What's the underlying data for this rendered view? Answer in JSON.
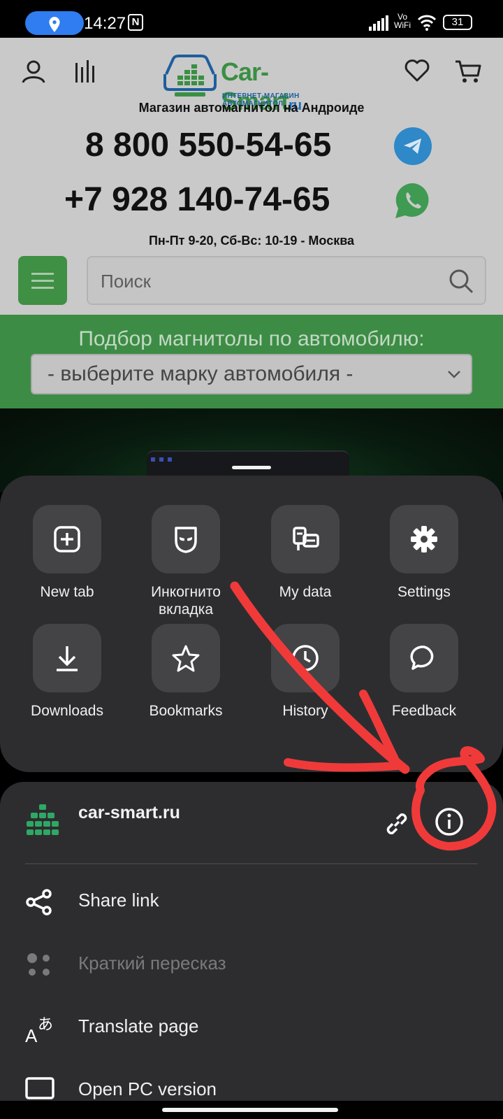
{
  "status_bar": {
    "time": "14:27",
    "nfc_label": "N",
    "network_label_1": "Vo",
    "network_label_2": "WiFi",
    "battery": "31"
  },
  "site": {
    "logo_name": "Car-Smart",
    "logo_tld": "ru",
    "logo_tagline": "ИНТЕРНЕТ-МАГАЗИН АВТОМАГНИТОЛ",
    "tagline": "Магазин автомагнитол на Андроиде",
    "phone_1": "8 800 550-54-65",
    "phone_2": "+7 928 140-74-65",
    "hours": "Пн-Пт 9-20, Сб-Вс: 10-19 - Москва",
    "search_placeholder": "Поиск",
    "picker_title": "Подбор магнитолы по автомобилю:",
    "picker_value": "- выберите марку автомобиля -"
  },
  "menu": {
    "tiles": [
      {
        "label": "New tab",
        "icon": "plus-square-icon"
      },
      {
        "label": "Инкогнито вкладка",
        "icon": "incognito-mask-icon"
      },
      {
        "label": "My data",
        "icon": "my-data-icon"
      },
      {
        "label": "Settings",
        "icon": "gear-icon"
      },
      {
        "label": "Downloads",
        "icon": "download-icon"
      },
      {
        "label": "Bookmarks",
        "icon": "star-icon"
      },
      {
        "label": "History",
        "icon": "clock-icon"
      },
      {
        "label": "Feedback",
        "icon": "chat-bubble-icon"
      }
    ],
    "site_domain": "car-smart.ru",
    "items": [
      {
        "label": "Share link",
        "icon": "share-icon",
        "enabled": true
      },
      {
        "label": "Краткий пересказ",
        "icon": "summary-icon",
        "enabled": false
      },
      {
        "label": "Translate page",
        "icon": "translate-icon",
        "enabled": true
      },
      {
        "label": "Open PC version",
        "icon": "desktop-icon",
        "enabled": true
      }
    ]
  },
  "colors": {
    "sheet_bg": "#2d2d30",
    "site_green": "#3d8c45",
    "annotation_red": "#f03a3a"
  }
}
